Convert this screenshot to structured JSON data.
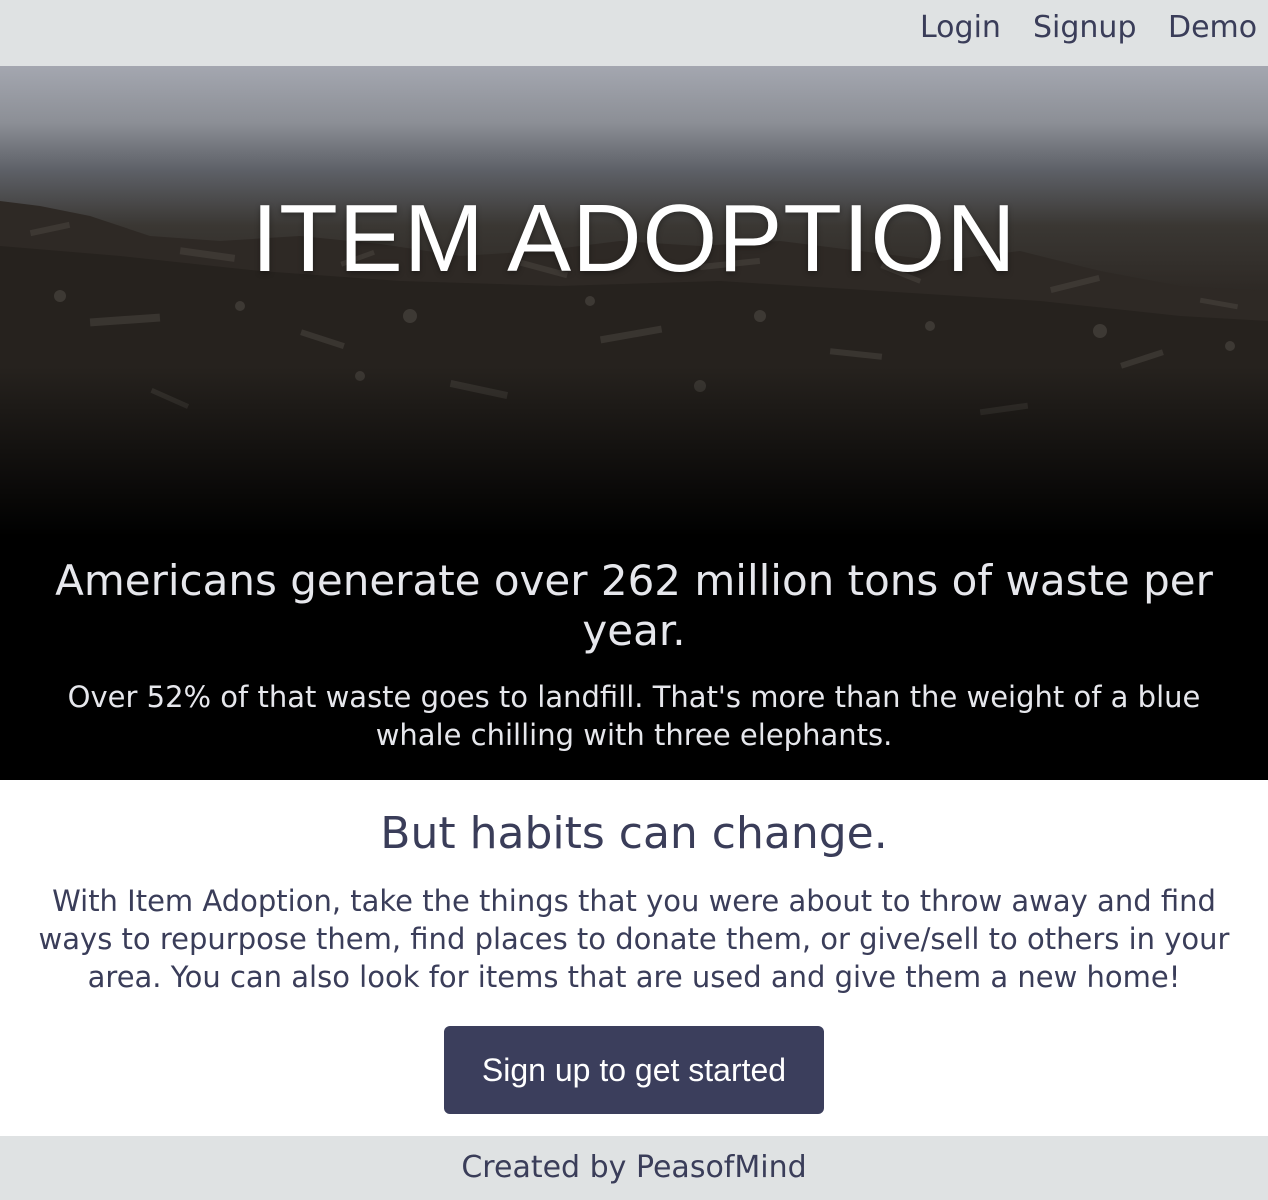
{
  "nav": {
    "login": "Login",
    "signup": "Signup",
    "demo": "Demo"
  },
  "hero": {
    "title": "ITEM ADOPTION",
    "stat": "Americans generate over 262 million tons of waste per year.",
    "subtext": "Over 52% of that waste goes to landfill. That's more than the weight of a blue whale chilling with three elephants."
  },
  "main": {
    "heading": "But habits can change.",
    "body": "With Item Adoption, take the things that you were about to throw away and find ways to repurpose them, find places to donate them, or give/sell to others in your area. You can also look for items that are used and give them a new home!",
    "cta_label": "Sign up to get started"
  },
  "footer": {
    "credit": "Created by PeasofMind"
  },
  "colors": {
    "nav_background": "#dfe2e3",
    "text_primary": "#3a3d59",
    "button_background": "#3b3e5c",
    "hero_text": "#e6e7ec"
  }
}
